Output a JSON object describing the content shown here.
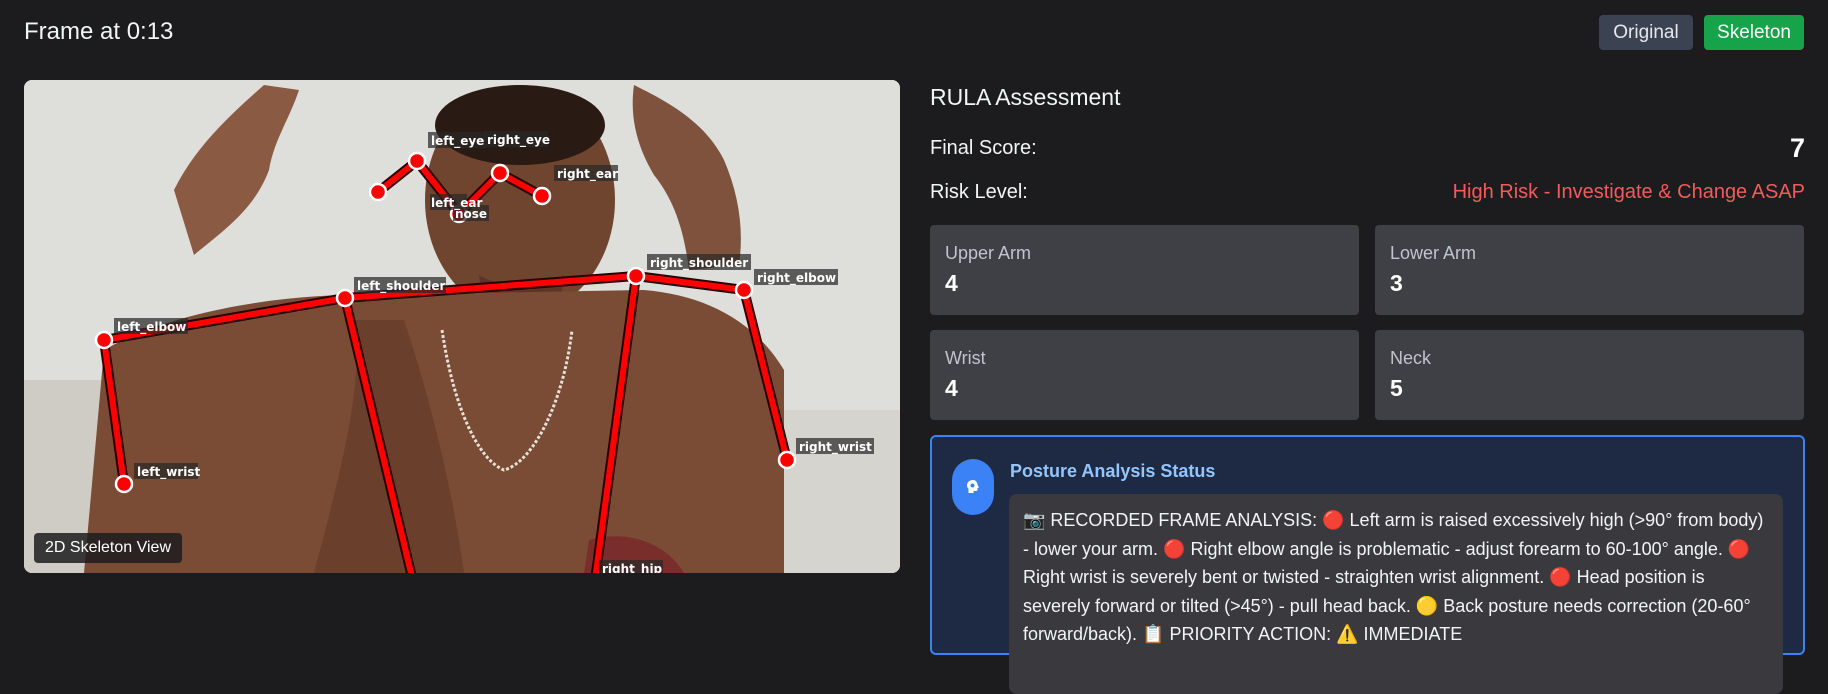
{
  "header": {
    "frame_title": "Frame at 0:13",
    "original_label": "Original",
    "skeleton_label": "Skeleton"
  },
  "viewer": {
    "view_badge": "2D Skeleton View",
    "keypoint_labels": {
      "left_eye": "left_eye",
      "right_eye": "right_eye",
      "left_ear": "left_ear",
      "right_ear": "right_ear",
      "nose": "nose",
      "left_shoulder": "left_shoulder",
      "right_shoulder": "right_shoulder",
      "left_elbow": "left_elbow",
      "right_elbow": "right_elbow",
      "left_wrist": "left_wrist",
      "right_wrist": "right_wrist",
      "right_hip": "right_hip"
    },
    "skeleton_color": "#ff0000",
    "keypoint_color": "#ff0000"
  },
  "rula": {
    "title": "RULA Assessment",
    "final_score_label": "Final Score:",
    "final_score": "7",
    "risk_label": "Risk Level:",
    "risk_value": "High Risk - Investigate & Change ASAP",
    "risk_color": "#f05c5c",
    "metrics": [
      {
        "label": "Upper Arm",
        "value": "4"
      },
      {
        "label": "Lower Arm",
        "value": "3"
      },
      {
        "label": "Wrist",
        "value": "4"
      },
      {
        "label": "Neck",
        "value": "5"
      }
    ]
  },
  "status": {
    "icon": "brain-icon",
    "title": "Posture Analysis Status",
    "message": "📷 RECORDED FRAME ANALYSIS: 🔴 Left arm is raised excessively high (>90° from body) - lower your arm. 🔴 Right elbow angle is problematic - adjust forearm to 60-100° angle. 🔴 Right wrist is severely bent or twisted - straighten wrist alignment. 🔴 Head position is severely forward or tilted (>45°) - pull head back. 🟡 Back posture needs correction (20-60° forward/back). 📋 PRIORITY ACTION: ⚠️ IMMEDIATE"
  }
}
